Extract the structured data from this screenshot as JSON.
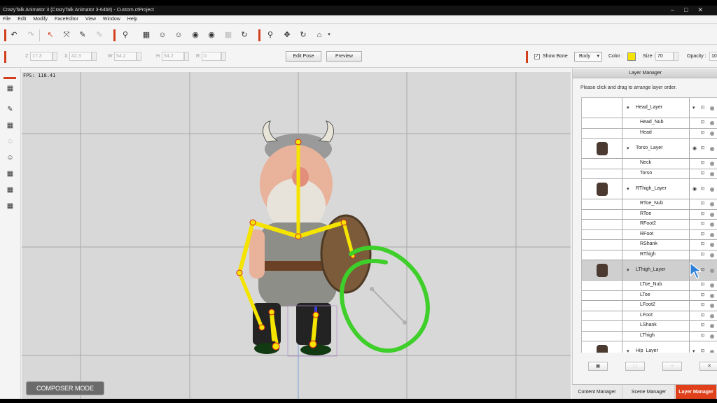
{
  "app": {
    "title": "CrazyTalk Animator 3  (CrazyTalk Animator 3-64bit) - Custom.ctProject",
    "window_controls": [
      "–",
      "□",
      "✕"
    ]
  },
  "menu": [
    "File",
    "Edit",
    "Modify",
    "FaceEditor",
    "View",
    "Window",
    "Help"
  ],
  "propbar": {
    "fields": [
      {
        "label": "Z",
        "value": "17.3"
      },
      {
        "label": "X",
        "value": "42.3"
      },
      {
        "label": "W",
        "value": "54.2"
      },
      {
        "label": "H",
        "value": "54.2"
      },
      {
        "label": "R",
        "value": "0"
      }
    ],
    "edit_pose": "Edit Pose",
    "preview": "Preview",
    "show_bone": "Show Bone",
    "body_select": "Body",
    "color_label": "Color :",
    "color_value": "#f5e400",
    "size_label": "Size :",
    "size_value": "70",
    "opacity_label": "Opacity :",
    "opacity_value": "10"
  },
  "viewport": {
    "fps": "FPS: 118.41",
    "mode_badge": "COMPOSER MODE",
    "bone_color": "#f5e400",
    "ring_color": "#3fcf2a"
  },
  "layer_manager": {
    "title": "Layer Manager",
    "instruction": "Please click and drag to arrange layer order.",
    "rows": [
      {
        "name": "Head_Layer",
        "group": true,
        "visible": false
      },
      {
        "name": "Head_Nub",
        "group": false
      },
      {
        "name": "Head",
        "group": false
      },
      {
        "name": "Torso_Layer",
        "group": true,
        "visible": true
      },
      {
        "name": "Neck",
        "group": false
      },
      {
        "name": "Torso",
        "group": false
      },
      {
        "name": "RThigh_Layer",
        "group": true,
        "visible": true
      },
      {
        "name": "RToe_Nub",
        "group": false
      },
      {
        "name": "RToe",
        "group": false
      },
      {
        "name": "RFoot2",
        "group": false
      },
      {
        "name": "RFoot",
        "group": false
      },
      {
        "name": "RShank",
        "group": false
      },
      {
        "name": "RThigh",
        "group": false
      },
      {
        "name": "LThigh_Layer",
        "group": true,
        "visible": true,
        "selected": true
      },
      {
        "name": "LToe_Nub",
        "group": false
      },
      {
        "name": "LToe",
        "group": false
      },
      {
        "name": "LFoot2",
        "group": false
      },
      {
        "name": "LFoot",
        "group": false
      },
      {
        "name": "LShank",
        "group": false
      },
      {
        "name": "LThigh",
        "group": false
      },
      {
        "name": "Hip_Layer",
        "group": true,
        "visible": false
      }
    ],
    "bottom_buttons": [
      "▣",
      "▢",
      "+",
      "✕"
    ]
  },
  "tabs": [
    "Content Manager",
    "Scene Manager",
    "Layer Manager"
  ],
  "icons": {
    "undo": "↶",
    "redo": "↷",
    "select": "↖",
    "transform": "⤧",
    "pin": "✎",
    "bone": "⚲",
    "grid": "▦",
    "head": "☺",
    "move": "✥",
    "rotate": "↻",
    "home": "⌂",
    "eye": "◉",
    "lock": "🔒",
    "chevron": "▾"
  }
}
